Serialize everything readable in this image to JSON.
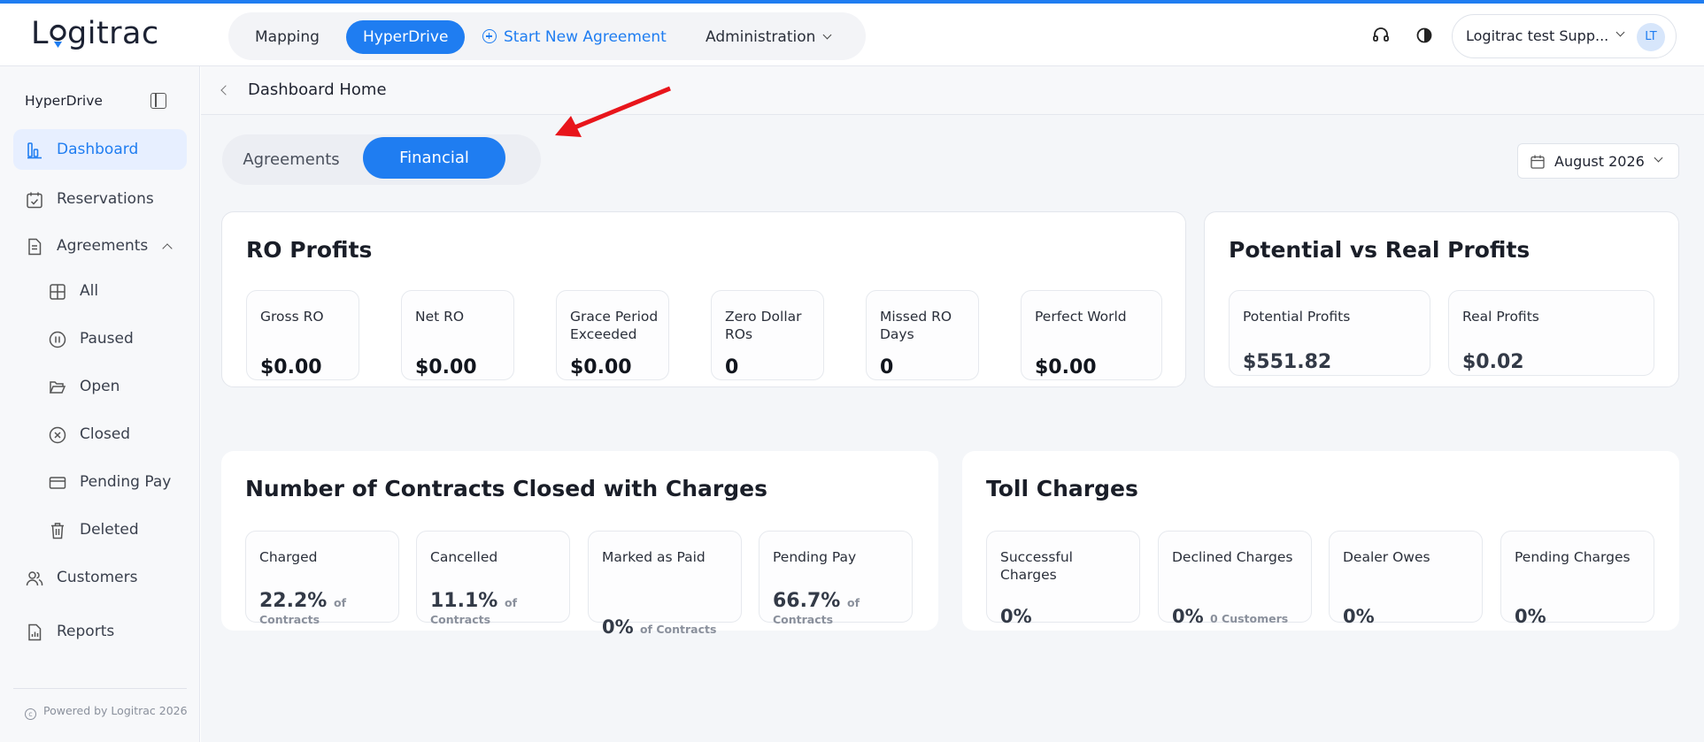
{
  "app": {
    "logo_pre": "L",
    "logo_post": "gitrac"
  },
  "nav": {
    "mapping": "Mapping",
    "hyperdrive": "HyperDrive",
    "start_new": "Start New Agreement",
    "administration": "Administration"
  },
  "account": {
    "name": "Logitrac test Supp...",
    "initials": "LT"
  },
  "sidebar": {
    "title": "HyperDrive",
    "items": [
      {
        "label": "Dashboard",
        "icon": "chart-icon"
      },
      {
        "label": "Reservations",
        "icon": "calendar-check-icon"
      },
      {
        "label": "Agreements",
        "icon": "document-icon"
      },
      {
        "label": "All",
        "icon": "grid-icon"
      },
      {
        "label": "Paused",
        "icon": "pause-icon"
      },
      {
        "label": "Open",
        "icon": "folder-open-icon"
      },
      {
        "label": "Closed",
        "icon": "x-circle-icon"
      },
      {
        "label": "Pending Pay",
        "icon": "credit-card-icon"
      },
      {
        "label": "Deleted",
        "icon": "trash-icon"
      },
      {
        "label": "Customers",
        "icon": "users-icon"
      },
      {
        "label": "Reports",
        "icon": "report-icon"
      }
    ],
    "footer": "Powered by Logitrac 2026"
  },
  "breadcrumb": {
    "title": "Dashboard Home"
  },
  "tabs": {
    "agreements": "Agreements",
    "financial": "Financial"
  },
  "date_picker": {
    "value": "August 2026"
  },
  "ro_profits": {
    "title": "RO Profits",
    "tiles": [
      {
        "label": "Gross RO",
        "value": "$0.00"
      },
      {
        "label": "Net RO",
        "value": "$0.00"
      },
      {
        "label": "Grace Period Exceeded",
        "value": "$0.00"
      },
      {
        "label": "Zero Dollar ROs",
        "value": "0"
      },
      {
        "label": "Missed RO Days",
        "value": "0"
      },
      {
        "label": "Perfect World",
        "value": "$0.00"
      }
    ]
  },
  "potential": {
    "title": "Potential vs Real Profits",
    "tiles": [
      {
        "label": "Potential Profits",
        "value": "$551.82"
      },
      {
        "label": "Real Profits",
        "value": "$0.02"
      }
    ]
  },
  "contracts": {
    "title": "Number of Contracts Closed with Charges",
    "tiles": [
      {
        "label": "Charged",
        "value": "22.2%",
        "suffix": "of",
        "suffix2": "Contracts"
      },
      {
        "label": "Cancelled",
        "value": "11.1%",
        "suffix": "of",
        "suffix2": "Contracts"
      },
      {
        "label": "Marked as Paid",
        "value": "0%",
        "suffix": "of Contracts"
      },
      {
        "label": "Pending Pay",
        "value": "66.7%",
        "suffix": "of",
        "suffix2": "Contracts"
      }
    ]
  },
  "toll": {
    "title": "Toll Charges",
    "tiles": [
      {
        "label": "Successful Charges",
        "value": "0%"
      },
      {
        "label": "Declined Charges",
        "value": "0%",
        "suffix": "0 Customers"
      },
      {
        "label": "Dealer Owes",
        "value": "0%"
      },
      {
        "label": "Pending Charges",
        "value": "0%"
      }
    ]
  },
  "colors": {
    "accent": "#1f7df1",
    "annotation_arrow": "#e8151b"
  }
}
